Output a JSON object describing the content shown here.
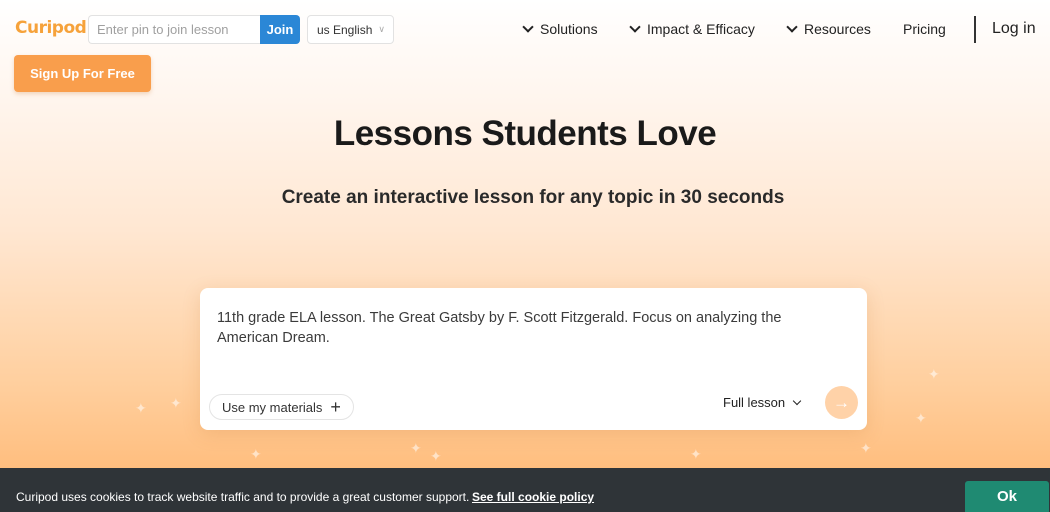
{
  "header": {
    "logo": "Curipod",
    "pin_placeholder": "Enter pin to join lesson",
    "join_label": "Join",
    "language": "us English",
    "nav": [
      {
        "label": "Solutions"
      },
      {
        "label": "Impact & Efficacy"
      },
      {
        "label": "Resources"
      },
      {
        "label": "Pricing"
      }
    ],
    "login": "Log in",
    "signup": "Sign Up For Free"
  },
  "hero": {
    "title": "Lessons Students Love",
    "subtitle": "Create an interactive lesson for any topic in 30 seconds"
  },
  "prompt": {
    "text": "11th grade ELA lesson. The Great Gatsby by F. Scott Fitzgerald. Focus on analyzing the American Dream.",
    "materials_label": "Use my materials",
    "lesson_type": "Full lesson"
  },
  "cookie": {
    "message": "Curipod uses cookies to track website traffic and to provide a great customer support.",
    "link": "See full cookie policy",
    "ok": "Ok"
  },
  "colors": {
    "brand_orange": "#f99e4c",
    "join_blue": "#2b87d6",
    "ok_green": "#1f8a72",
    "cookie_bg": "#2f3438"
  }
}
